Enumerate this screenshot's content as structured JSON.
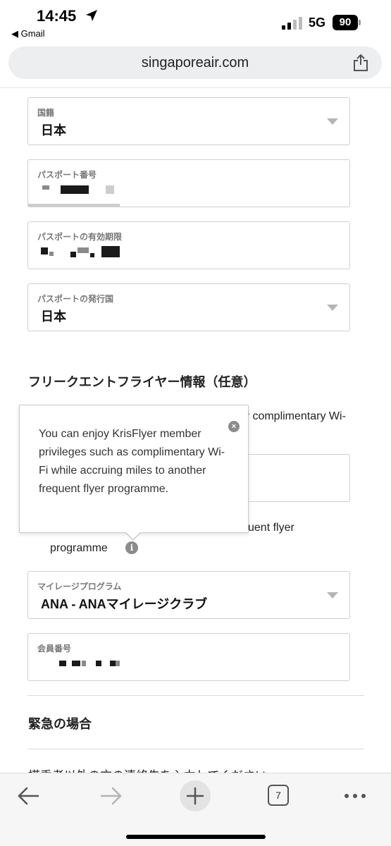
{
  "status_bar": {
    "time": "14:45",
    "back_app": "◀ Gmail",
    "network": "5G",
    "battery": "90"
  },
  "browser": {
    "url": "singaporeair.com"
  },
  "form": {
    "nationality": {
      "label": "国籍",
      "value": "日本"
    },
    "passport_number": {
      "label": "パスポート番号"
    },
    "passport_expiry": {
      "label": "パスポートの有効期限"
    },
    "passport_country": {
      "label": "パスポートの発行国",
      "value": "日本"
    },
    "frequent_flyer_title": "フリークエントフライヤー情報（任意）",
    "partial_line_1": "y complimentary Wi-",
    "partial_line_2": "uent flyer",
    "partial_line_3": "programme",
    "mileage_program": {
      "label": "マイレージプログラム",
      "value": "ANA - ANAマイレージクラブ"
    },
    "member_number": {
      "label": "会員番号"
    },
    "emergency_title": "緊急の場合",
    "emergency_partial": "搭乗者以外の方の連絡先を入力してください"
  },
  "tooltip": {
    "text": "You can enjoy KrisFlyer member privileges such as complimentary Wi-Fi while accruing miles to another frequent flyer programme."
  },
  "toolbar": {
    "tabs_count": "7"
  }
}
